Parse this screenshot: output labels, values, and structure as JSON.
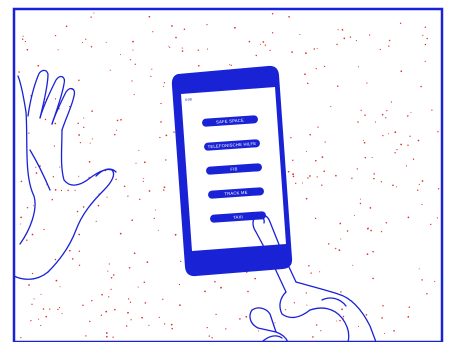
{
  "phone": {
    "status_time": "9:08",
    "buttons": [
      {
        "label": "SAFE SPACE"
      },
      {
        "label": "TELEFONISCHE HILFE"
      },
      {
        "label": "FIB"
      },
      {
        "label": "TRACK ME"
      },
      {
        "label": "TAXI"
      }
    ]
  },
  "colors": {
    "ink": "#1a22d6",
    "screen": "#ffffff",
    "dots": "#e0302a",
    "background": "#ffffff"
  }
}
